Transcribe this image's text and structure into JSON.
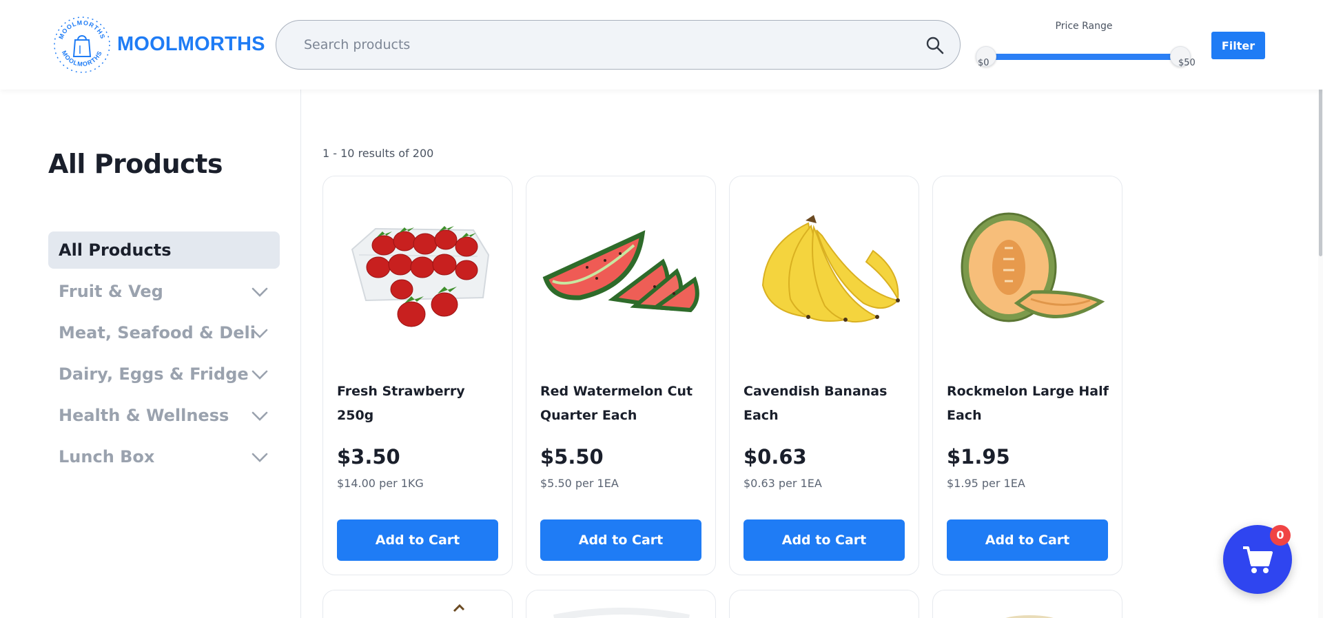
{
  "header": {
    "brand_name": "MOOLMORTHS",
    "logo_ring_text": "MOOLMORTHS",
    "search": {
      "placeholder": "Search products",
      "value": ""
    },
    "price_range": {
      "title": "Price Range",
      "min_label": "$0",
      "max_label": "$50",
      "min_value": 0,
      "max_value": 50
    },
    "filter_label": "Filter",
    "accent_color": "#1f7cf5"
  },
  "sidebar": {
    "title": "All Products",
    "categories": [
      {
        "label": "All Products",
        "active": true,
        "expandable": false
      },
      {
        "label": "Fruit & Veg",
        "active": false,
        "expandable": true,
        "icon": "chevron-down-icon"
      },
      {
        "label": "Meat, Seafood & Deli",
        "active": false,
        "expandable": true,
        "icon": "chevron-down-icon"
      },
      {
        "label": "Dairy, Eggs & Fridge",
        "active": false,
        "expandable": true,
        "icon": "chevron-down-icon"
      },
      {
        "label": "Health & Wellness",
        "active": false,
        "expandable": true,
        "icon": "chevron-down-icon"
      },
      {
        "label": "Lunch Box",
        "active": false,
        "expandable": true,
        "icon": "chevron-down-icon"
      }
    ]
  },
  "main": {
    "results_text": "1 - 10 results of 200",
    "products": [
      {
        "name": "Fresh Strawberry 250g",
        "price": "$3.50",
        "unit_price": "$14.00 per 1KG",
        "button_label": "Add to Cart",
        "image": "strawberry-punnet"
      },
      {
        "name": "Red Watermelon Cut Quarter Each",
        "price": "$5.50",
        "unit_price": "$5.50 per 1EA",
        "button_label": "Add to Cart",
        "image": "watermelon-wedge"
      },
      {
        "name": "Cavendish Bananas Each",
        "price": "$0.63",
        "unit_price": "$0.63 per 1EA",
        "button_label": "Add to Cart",
        "image": "banana-bunch"
      },
      {
        "name": "Rockmelon Large Half Each",
        "price": "$1.95",
        "unit_price": "$1.95 per 1EA",
        "button_label": "Add to Cart",
        "image": "rockmelon-half"
      }
    ]
  },
  "cart": {
    "count": "0",
    "icon": "shopping-cart-icon",
    "color": "#2f45f0",
    "badge_color": "#f04444"
  }
}
